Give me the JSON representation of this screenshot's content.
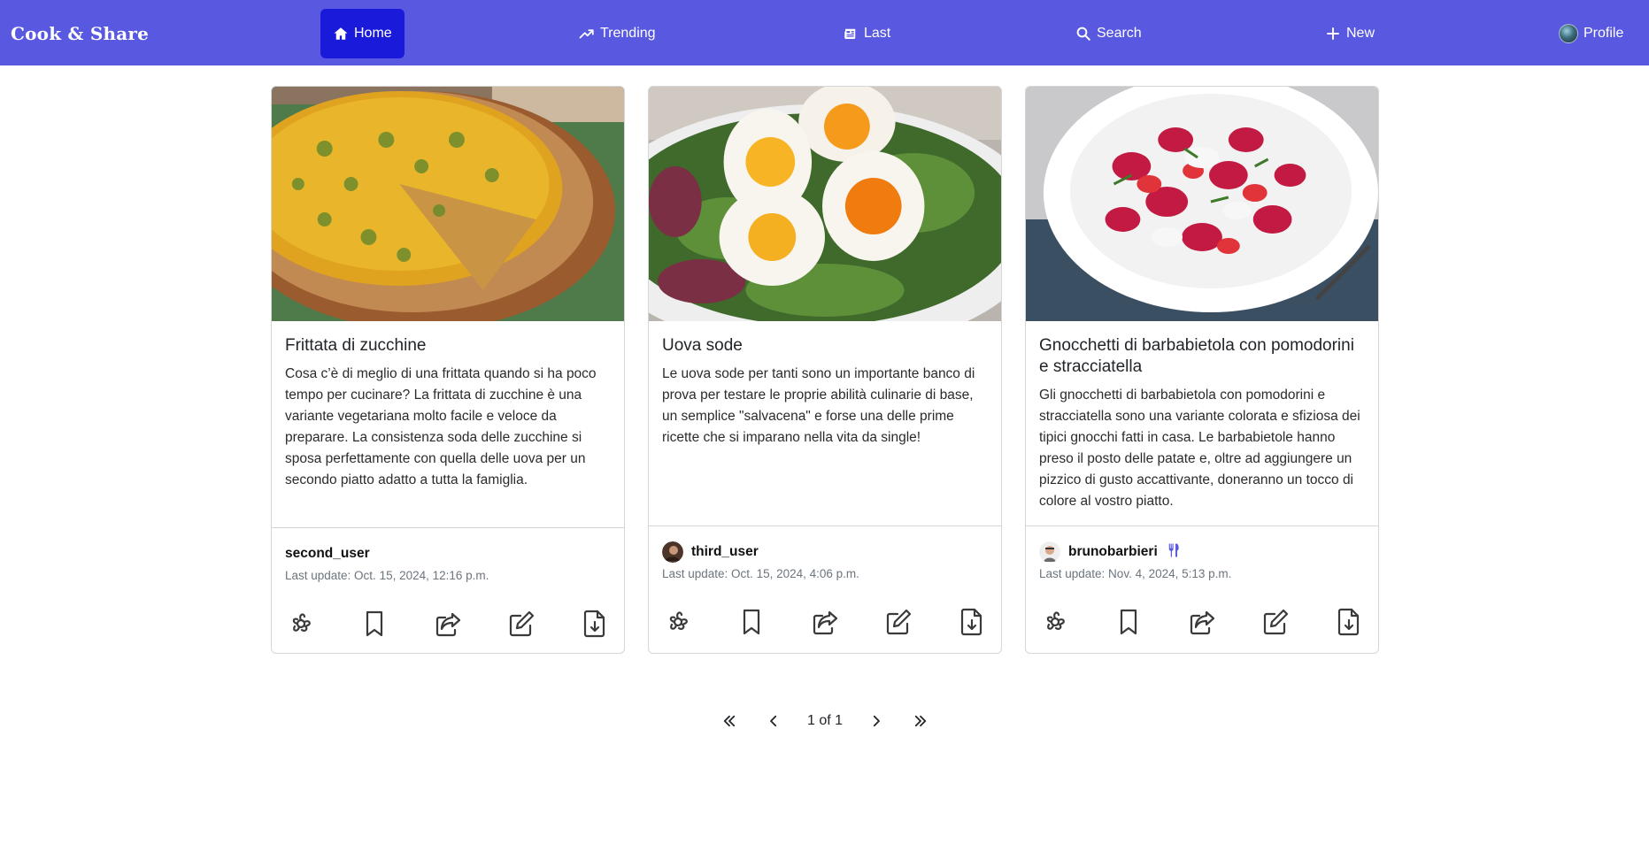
{
  "app": {
    "brand": "Cook & Share"
  },
  "nav": {
    "home": "Home",
    "trending": "Trending",
    "last": "Last",
    "search": "Search",
    "new": "New",
    "profile": "Profile"
  },
  "recipes": [
    {
      "title": "Frittata di zucchine",
      "description": "Cosa c’è di meglio di una frittata quando si ha poco tempo per cucinare? La frittata di zucchine è una variante vegetariana molto facile e veloce da preparare. La consistenza soda delle zucchine si sposa perfettamente con quella delle uova per un secondo piatto adatto a tutta la famiglia.",
      "author": "second_user",
      "updated": "Last update: Oct. 15, 2024, 12:16 p.m."
    },
    {
      "title": "Uova sode",
      "description": "Le uova sode per tanti sono un importante banco di prova per testare le proprie abilità culinarie di base, un semplice \"salvacena\" e forse una delle prime ricette che si imparano nella vita da single!",
      "author": "third_user",
      "updated": "Last update: Oct. 15, 2024, 4:06 p.m."
    },
    {
      "title": "Gnocchetti di barbabietola con pomodorini e stracciatella",
      "description": "Gli gnocchetti di barbabietola con pomodorini e stracciatella sono una variante colorata e sfiziosa dei tipici gnocchi fatti in casa. Le barbabietole hanno preso il posto delle patate e, oltre ad aggiungere un pizzico di gusto accattivante, doneranno un tocco di colore al vostro piatto.",
      "author": "brunobarbieri",
      "updated": "Last update: Nov. 4, 2024, 5:13 p.m."
    }
  ],
  "pagination": {
    "label": "1 of 1"
  },
  "colors": {
    "navbar": "#5858e0",
    "active": "#1a1adb"
  }
}
